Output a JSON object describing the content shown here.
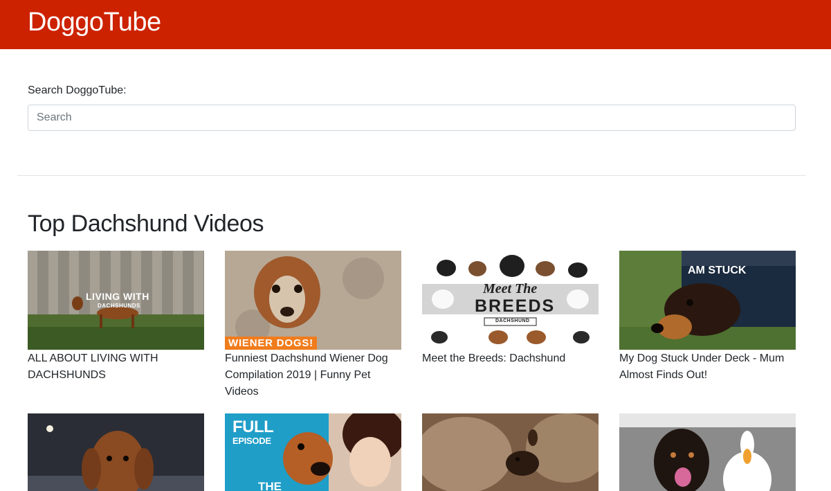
{
  "brand": {
    "name": "DoggoTube",
    "color": "#cc2200"
  },
  "search": {
    "label": "Search DoggoTube:",
    "placeholder": "Search",
    "value": ""
  },
  "section": {
    "title": "Top Dachshund Videos"
  },
  "videos": [
    {
      "title": "ALL ABOUT LIVING WITH DACHSHUNDS",
      "thumb_text": "LIVING WITH",
      "thumb_subtext": "DACHSHUNDS"
    },
    {
      "title": "Funniest Dachshund Wiener Dog Compilation 2019 | Funny Pet Videos",
      "thumb_text": "WIENER DOGS!"
    },
    {
      "title": "Meet the Breeds: Dachshund",
      "thumb_text": "Meet The",
      "thumb_subtext": "BREEDS",
      "thumb_caption": "DACHSHUND"
    },
    {
      "title": "My Dog Stuck Under Deck - Mum Almost Finds Out!",
      "thumb_text": "AM STUCK"
    },
    {
      "title": ""
    },
    {
      "title": "",
      "thumb_text": "FULL",
      "thumb_subtext": "EPISODE",
      "thumb_caption": "THE"
    },
    {
      "title": ""
    },
    {
      "title": ""
    }
  ]
}
